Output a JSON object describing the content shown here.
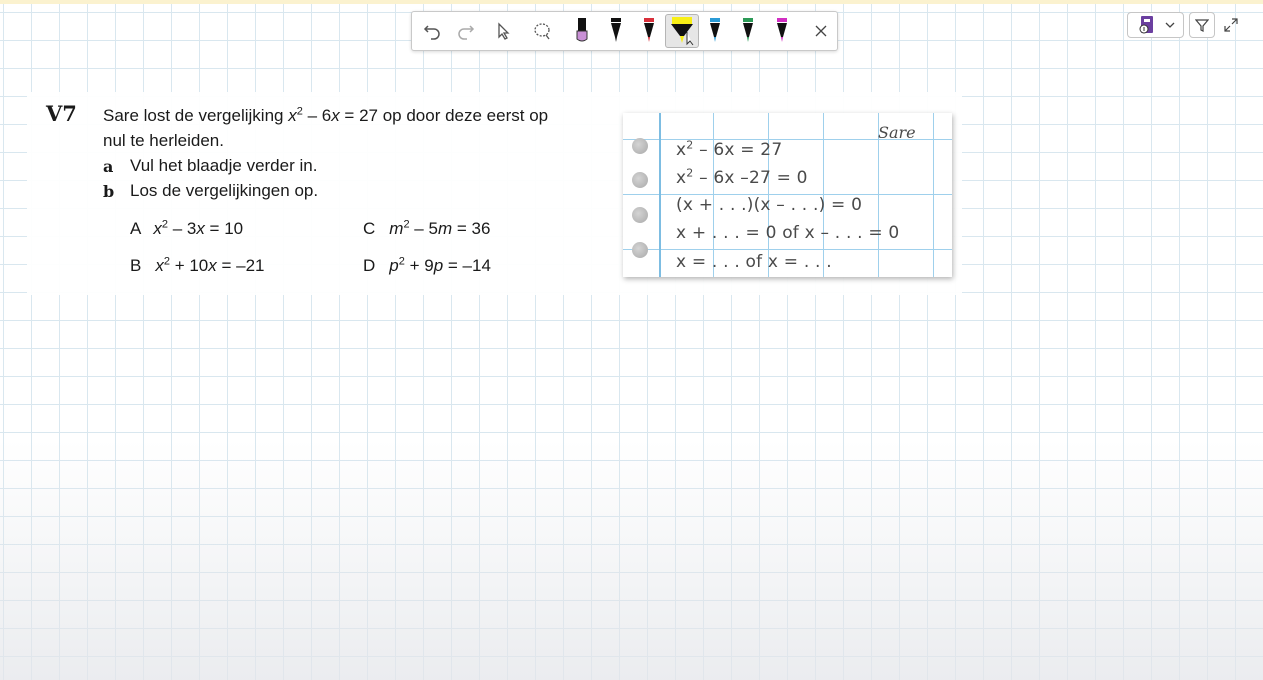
{
  "toolbar": {
    "tools": [
      "undo-icon",
      "redo-icon",
      "select-icon",
      "lasso-icon",
      "pen-lilac",
      "pen-black",
      "pen-red",
      "highlighter-yellow",
      "pen-blue",
      "pen-green",
      "pen-magenta",
      "close-icon"
    ],
    "selected_tool": "highlighter-yellow",
    "pen_colors": {
      "lilac": "#c990d6",
      "black": "#111111",
      "red": "#d9303b",
      "yellow": "#f8ef16",
      "blue": "#2a9bd6",
      "green": "#2c9a57",
      "magenta": "#d22ec3"
    }
  },
  "view_controls": [
    "notebook-icon",
    "chevron-down-icon",
    "filter-icon",
    "expand-icon"
  ],
  "exercise": {
    "number": "V7",
    "intro_line1_pre": "Sare lost de vergelijking ",
    "intro_eq_var": "x",
    "intro_eq_exp": "2",
    "intro_eq_rest_pre": " – 6",
    "intro_eq_var2": "x",
    "intro_eq_rest": " = 27 op door deze eerst op",
    "intro_line2": "nul te herleiden.",
    "a_letter": "a",
    "a_text": "Vul het blaadje verder in.",
    "b_letter": "b",
    "b_text": "Los de vergelijkingen op.",
    "equations": {
      "A": {
        "label": "A",
        "var": "x",
        "exp": "2",
        "mid": " – 3",
        "var2": "x",
        "rest": " = 10"
      },
      "B": {
        "label": "B",
        "var": "x",
        "exp": "2",
        "mid": " + 10",
        "var2": "x",
        "rest": " = –21"
      },
      "C": {
        "label": "C",
        "var": "m",
        "exp": "2",
        "mid": " – 5",
        "var2": "m",
        "rest": " = 36"
      },
      "D": {
        "label": "D",
        "var": "p",
        "exp": "2",
        "mid": " + 9",
        "var2": "p",
        "rest": " = –14"
      }
    }
  },
  "paper": {
    "name": "Sare",
    "line1_var": "x",
    "line1_exp": "2",
    "line1_rest": " – 6x = 27",
    "line2_var": "x",
    "line2_exp": "2",
    "line2_rest": " – 6x –27 = 0",
    "line3": "(x + . . .)(x – . . .) = 0",
    "line4": "x + . . . = 0 of x – . . . = 0",
    "line5": "x = . . . of x = . . ."
  }
}
